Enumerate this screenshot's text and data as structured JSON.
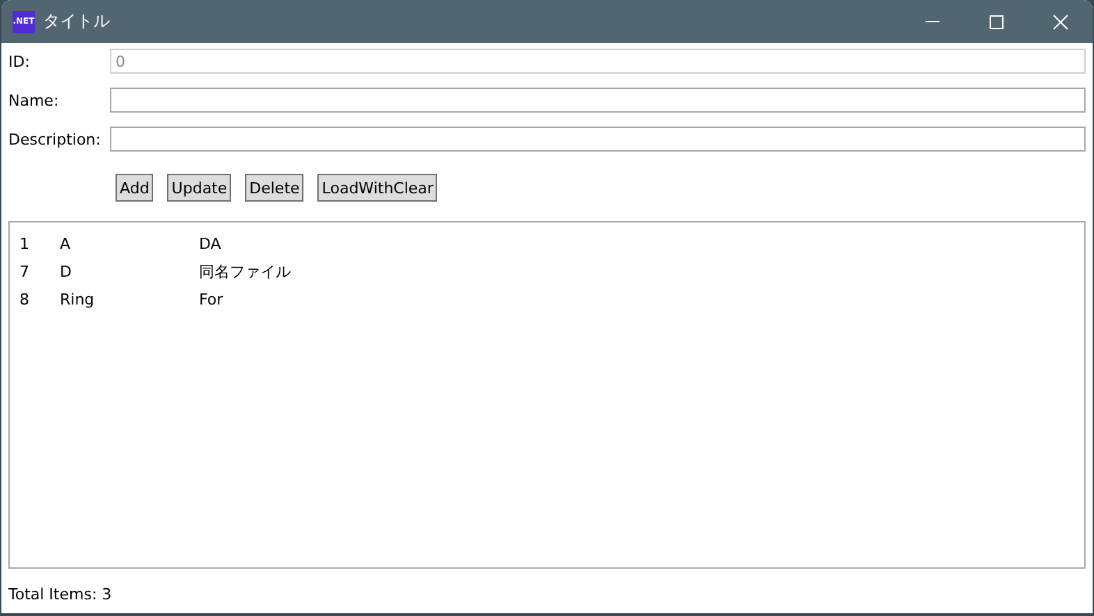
{
  "window": {
    "app_badge": ".NET",
    "title": "タイトル"
  },
  "form": {
    "fields": [
      {
        "label": "ID:",
        "value": "0",
        "disabled": true
      },
      {
        "label": "Name:",
        "disabled": false
      },
      {
        "label": "Description:",
        "disabled": false
      }
    ]
  },
  "buttons": [
    "Add",
    "Update",
    "Delete",
    "LoadWithClear"
  ],
  "list": {
    "rows": [
      {
        "cells": [
          "1",
          "A",
          "DA"
        ]
      },
      {
        "cells": [
          "7",
          "D",
          "同名ファイル"
        ]
      },
      {
        "cells": [
          "8",
          "Ring",
          "For"
        ]
      }
    ]
  },
  "status_bar": "Total Items: 3"
}
